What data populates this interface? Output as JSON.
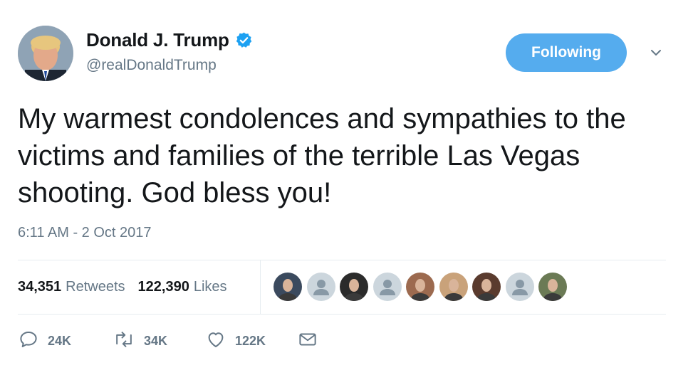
{
  "author": {
    "name": "Donald J. Trump",
    "handle": "@realDonaldTrump",
    "verified": true,
    "avatar_icon": "profile-photo"
  },
  "follow_button": {
    "label": "Following",
    "color": "#55acee"
  },
  "menu_icon": "chevron-down-icon",
  "tweet": {
    "text": "My warmest condolences and sympathies to the victims and families of the terrible Las Vegas shooting. God bless you!",
    "timestamp": "6:11 AM - 2 Oct 2017"
  },
  "stats": {
    "retweets_count": "34,351",
    "retweets_label": "Retweets",
    "likes_count": "122,390",
    "likes_label": "Likes"
  },
  "liker_avatars": [
    {
      "kind": "photo",
      "color": "#3b4a5e"
    },
    {
      "kind": "default",
      "color": "#ccd6dd"
    },
    {
      "kind": "photo",
      "color": "#2b2b2b"
    },
    {
      "kind": "default",
      "color": "#ccd6dd"
    },
    {
      "kind": "photo",
      "color": "#9c6a4f"
    },
    {
      "kind": "photo",
      "color": "#c9a27a"
    },
    {
      "kind": "photo",
      "color": "#5a3b2e"
    },
    {
      "kind": "default",
      "color": "#ccd6dd"
    },
    {
      "kind": "photo",
      "color": "#6b7a55"
    }
  ],
  "actions": {
    "reply_icon": "reply-icon",
    "reply_count": "24K",
    "retweet_icon": "retweet-icon",
    "retweet_count": "34K",
    "like_icon": "heart-icon",
    "like_count": "122K",
    "message_icon": "envelope-icon"
  },
  "colors": {
    "text": "#14171a",
    "secondary": "#657786",
    "accent": "#55acee",
    "divider": "#e6ecf0",
    "verified": "#1da1f2"
  }
}
